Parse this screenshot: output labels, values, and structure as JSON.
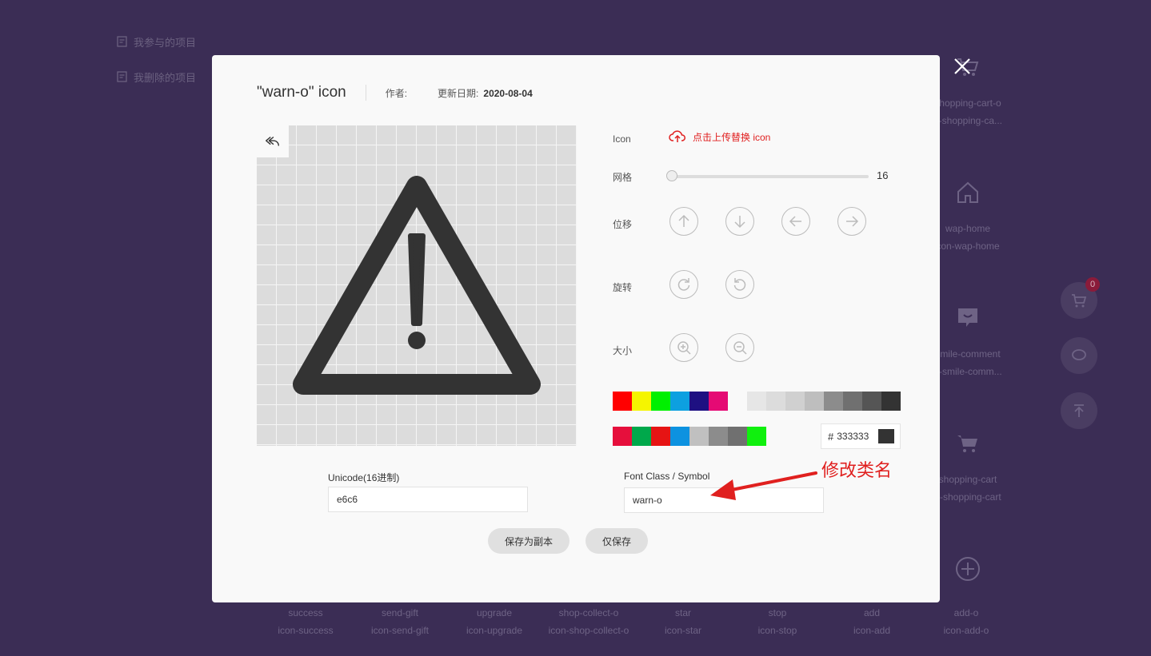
{
  "background": {
    "sidebar": [
      {
        "label": "我参与的项目",
        "icon": "document-icon"
      },
      {
        "label": "我删除的项目",
        "icon": "document-icon"
      }
    ],
    "right_icons": [
      {
        "name": "shopping-cart-o",
        "class": "n-shopping-ca...",
        "icon": "cart-icon"
      },
      {
        "name": "wap-home",
        "class": "con-wap-home",
        "icon": "home-icon"
      },
      {
        "name": "smile-comment",
        "class": "n-smile-comm...",
        "icon": "chat-icon"
      },
      {
        "name": "shopping-cart",
        "class": "n-shopping-cart",
        "icon": "cart-icon"
      },
      {
        "name": "",
        "class": "",
        "icon": "plus-circle-icon"
      }
    ],
    "bottom_icons": [
      {
        "name": "success",
        "class": "icon-success"
      },
      {
        "name": "send-gift",
        "class": "icon-send-gift"
      },
      {
        "name": "upgrade",
        "class": "icon-upgrade"
      },
      {
        "name": "shop-collect-o",
        "class": "icon-shop-collect-o"
      },
      {
        "name": "star",
        "class": "icon-star"
      },
      {
        "name": "stop",
        "class": "icon-stop"
      },
      {
        "name": "add",
        "class": "icon-add"
      },
      {
        "name": "add-o",
        "class": "icon-add-o"
      }
    ],
    "cart_badge": "0"
  },
  "modal": {
    "title": "\"warn-o\"  icon",
    "author_label": "作者:",
    "author_value": "",
    "date_label": "更新日期:",
    "date_value": "2020-08-04",
    "icon_label": "Icon",
    "upload_label": "点击上传替换 icon",
    "grid_label": "网格",
    "grid_value": "16",
    "grid_fraction": 0.0,
    "move_label": "位移",
    "rotate_label": "旋转",
    "size_label": "大小",
    "colors_row1_bright": [
      "#ff0000",
      "#f5f500",
      "#00f000",
      "#0da0e0",
      "#1e1082",
      "#e50a74"
    ],
    "colors_row1_gray": [
      "#e6e6e6",
      "#dcdcdc",
      "#d0d0d0",
      "#bebebe",
      "#8c8c8c",
      "#707070",
      "#555555",
      "#333333"
    ],
    "colors_row2": [
      "#e60f3c",
      "#00a84b",
      "#e61414",
      "#0d92e0",
      "#c0c0c0",
      "#8c8c8c",
      "#707070",
      "#10f00e"
    ],
    "current_color": "333333",
    "current_color_hex": "#333333",
    "unicode_label": "Unicode(16进制)",
    "unicode_value": "e6c6",
    "fontclass_label": "Font Class / Symbol",
    "fontclass_value": "warn-o",
    "save_copy_label": "保存为副本",
    "save_label": "仅保存"
  },
  "annotation": {
    "text": "修改类名",
    "color": "#e0201f"
  }
}
